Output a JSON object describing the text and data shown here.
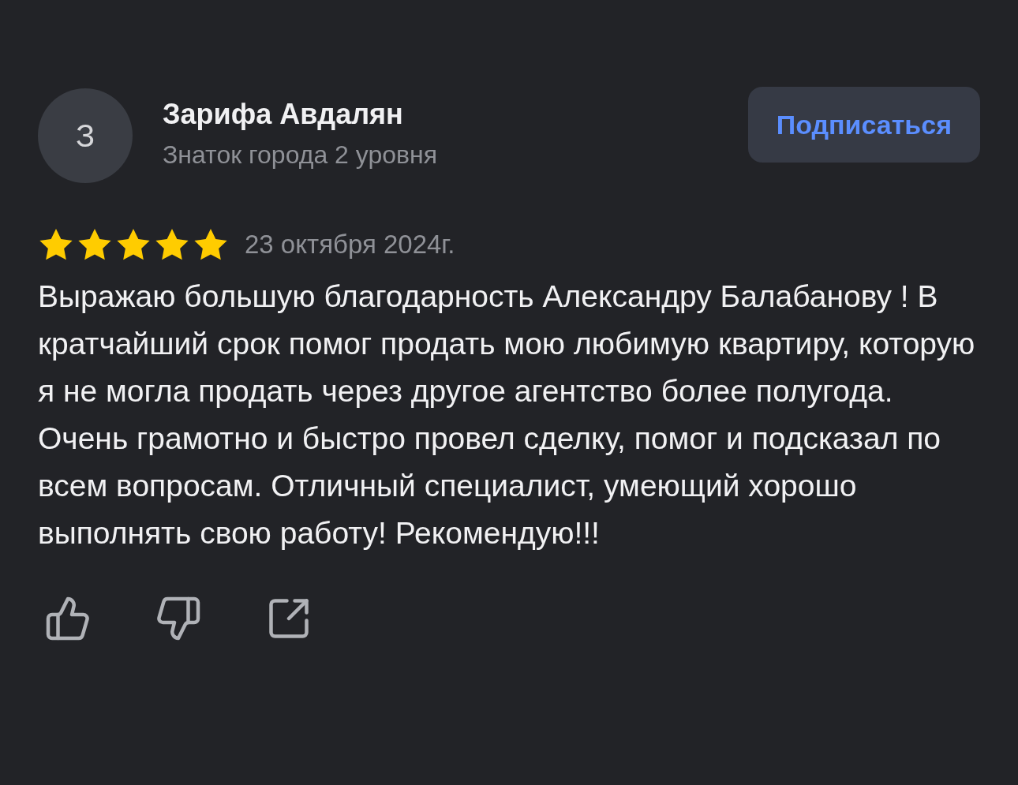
{
  "author": {
    "initial": "З",
    "name": "Зарифа Авдалян",
    "level": "Знаток города 2 уровня"
  },
  "subscribe_button": "Подписаться",
  "review": {
    "stars": 5,
    "date": "23 октября 2024г.",
    "text": "Выражаю большую благодарность Александру Балабанову ! В кратчайший срок помог продать мою любимую квартиру, которую я не могла продать через другое агентство более полугода. Очень грамотно и быстро провел сделку, помог и подсказал по всем вопросам. Отличный специалист, умеющий хорошо выполнять свою работу! Рекомендую!!!"
  },
  "actions": [
    {
      "kind": "like"
    },
    {
      "kind": "dislike"
    },
    {
      "kind": "share"
    }
  ]
}
